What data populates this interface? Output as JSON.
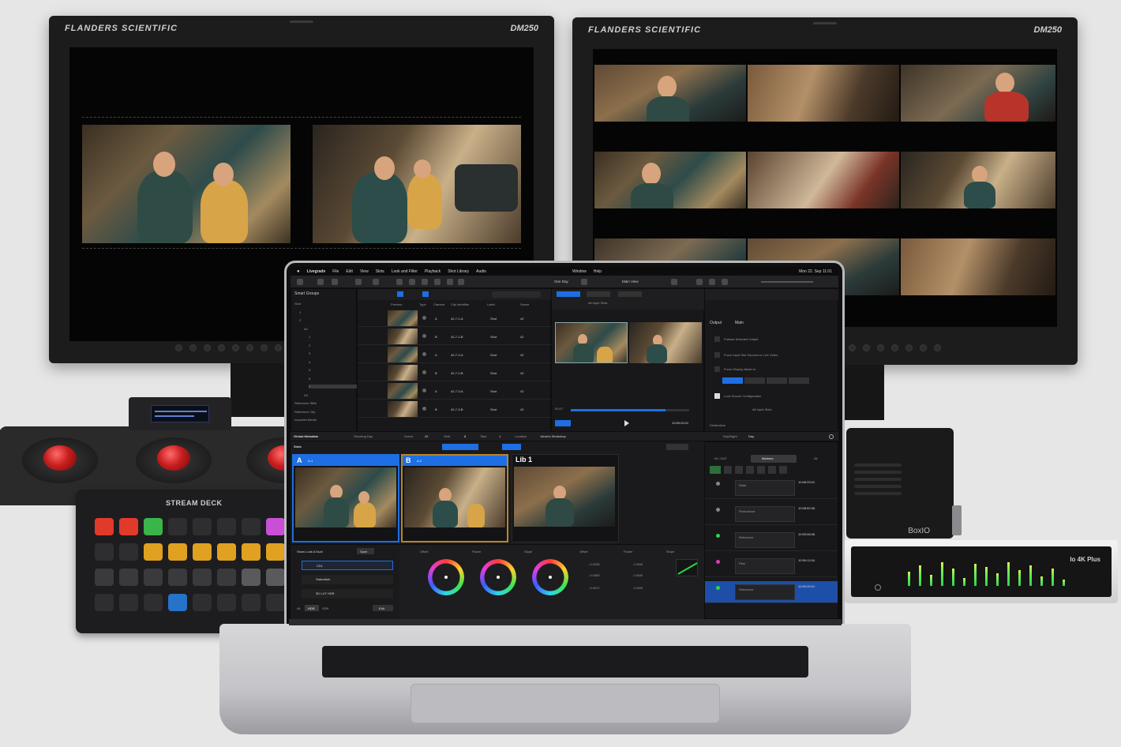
{
  "monitor_left": {
    "brand": "FLANDERS SCIENTIFIC",
    "model": "DM250"
  },
  "monitor_right": {
    "brand": "FLANDERS SCIENTIFIC",
    "model": "DM250"
  },
  "streamdeck": {
    "title": "STREAM DECK"
  },
  "boxio": {
    "label": "BoxIO"
  },
  "io4k": {
    "label": "Io 4K Plus"
  },
  "app": {
    "menu": [
      "Livegrade",
      "File",
      "Edit",
      "View",
      "Slots",
      "Look and Filter",
      "Playback",
      "Shot Library",
      "Audio",
      "Window",
      "Help"
    ],
    "clock": "Mon 22. Sep 11:01",
    "toolbar": {
      "day": "One Day",
      "view": "Main View"
    },
    "smart_groups": {
      "title": "Smart Groups",
      "items": [
        "Shot",
        "1",
        "2",
        "A2",
        "1",
        "2",
        "3",
        "4",
        "5",
        "6",
        "7",
        "A3",
        "Reference Stills",
        "Reference Clip",
        "Imported Media"
      ]
    },
    "columns": [
      "Preview",
      "Type",
      "Camera",
      "Clip Identifier",
      "Label",
      "Scene"
    ],
    "clips": [
      {
        "cam": "A",
        "id": "42-7-1-A",
        "label": "Shot",
        "scene": "42"
      },
      {
        "cam": "B",
        "id": "42-7-1-B",
        "label": "Shot",
        "scene": "42"
      },
      {
        "cam": "A",
        "id": "42-7-2-A",
        "label": "Shot",
        "scene": "42"
      },
      {
        "cam": "B",
        "id": "42-7-2-B",
        "label": "Shot",
        "scene": "42"
      },
      {
        "cam": "A",
        "id": "42-7-3-A",
        "label": "Shot",
        "scene": "42"
      },
      {
        "cam": "B",
        "id": "42-7-3-B",
        "label": "Shot",
        "scene": "42"
      }
    ],
    "input_slots": "All Input Slots",
    "output": {
      "tab1": "Output",
      "tab2": "Main",
      "opt1": "Follows Selected Output",
      "opt2": "Force Input Slot Sources to Live Video",
      "opt3": "Force Display Mode to",
      "opt4": "Lock Source Configuration",
      "destination": "Destination"
    },
    "timecode": {
      "start": "00:07",
      "end": "10:59:25:01"
    },
    "global_metadata": "Global Metadata",
    "metadata_fields": {
      "shooting_day": "Shooting Day",
      "scene": "Scene",
      "scene_val": "42",
      "shot": "Shot",
      "shot_val": "8",
      "take": "Take",
      "take_val": "1",
      "location": "Location",
      "location_val": "Johan's Workshop",
      "daynight": "Day/Night",
      "daynight_val": "Day"
    },
    "slots_title": "Slots",
    "slots": [
      {
        "name": "A",
        "sub": "A-1"
      },
      {
        "name": "B",
        "sub": "A-2"
      },
      {
        "name": "Lib 1",
        "sub": ""
      }
    ],
    "look": {
      "title": "Show Look A Dual",
      "save": "Save",
      "nodes": [
        "CDL",
        "Saturation",
        "3D LUT HDR"
      ],
      "modes": [
        "All",
        "HDR",
        "SDR"
      ],
      "edit": "Edit"
    },
    "grading": {
      "wheels": [
        "Offset",
        "Power",
        "Slope"
      ],
      "cols": [
        "Offset",
        "Power",
        "Slope"
      ],
      "values": [
        "-0.0345",
        "1.0000",
        "-0.0383",
        "1.0000",
        "-0.0017",
        "1.0000"
      ]
    },
    "markers": {
      "tabs": [
        "IN / OUT",
        "Markers",
        "All"
      ],
      "rows": [
        {
          "label": "Slate",
          "tc": "10:58:33:01"
        },
        {
          "label": "Photoshoot",
          "tc": "10:58:52:08"
        },
        {
          "label": "Reference",
          "tc": "10:59:08:08"
        },
        {
          "label": "Plan",
          "tc": "10:59:12:04"
        },
        {
          "label": "Reference",
          "tc": "10:59:25:01"
        }
      ]
    }
  },
  "colors": {
    "accent": "#1d6fe3",
    "slot_b": "#b8862e",
    "record": "#e23a2a",
    "meter": "#2bd64a"
  }
}
